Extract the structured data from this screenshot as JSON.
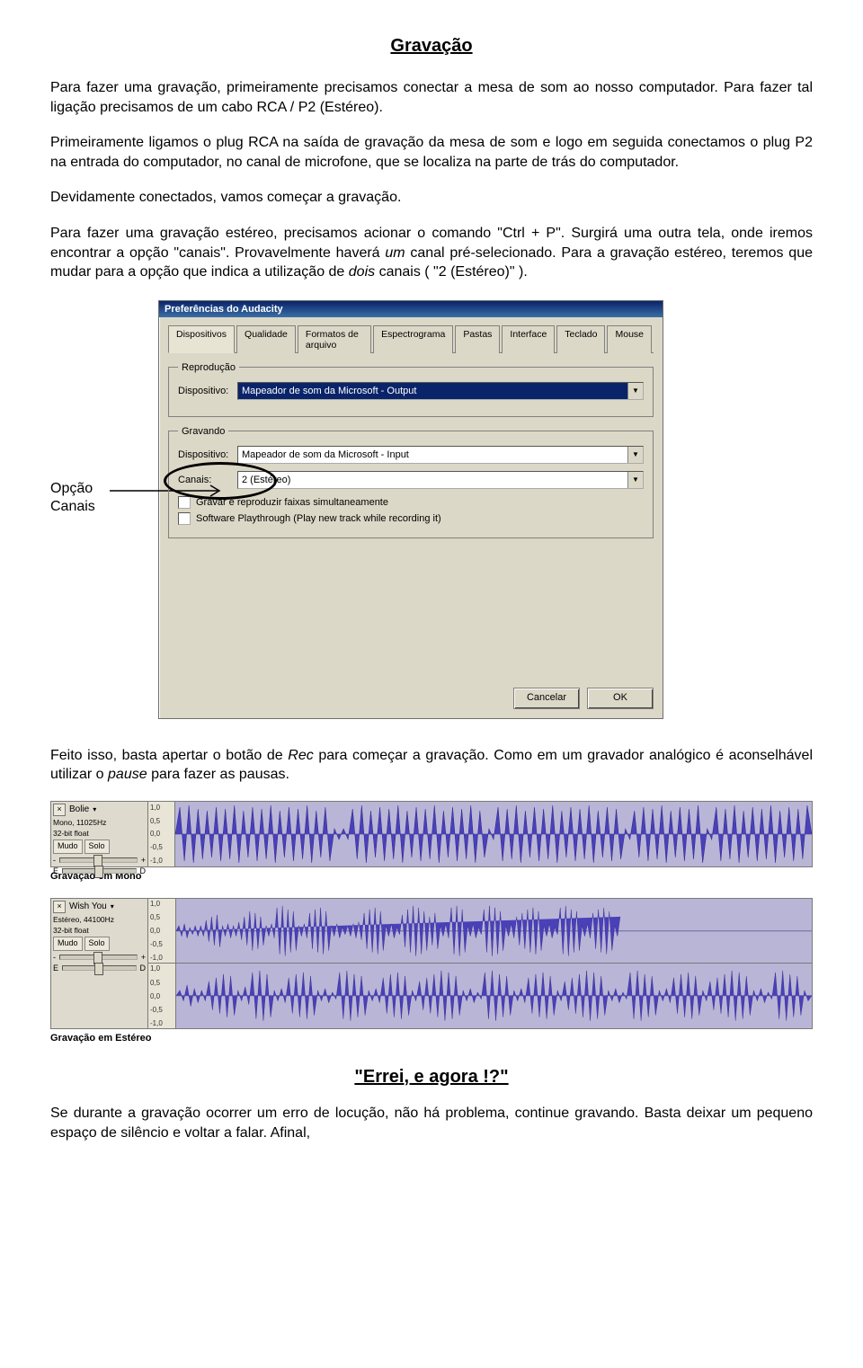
{
  "title": "Gravação",
  "para1": "Para fazer uma gravação, primeiramente precisamos conectar a mesa de som ao nosso computador. Para fazer tal ligação precisamos de um cabo RCA / P2 (Estéreo).",
  "para2": "Primeiramente ligamos o plug RCA na saída de gravação da mesa de som e logo em seguida conectamos o plug P2 na entrada do computador, no canal de microfone, que se localiza na parte de trás do computador.",
  "para3": "Devidamente conectados, vamos começar a gravação.",
  "para4a": "Para fazer uma gravação estéreo, precisamos acionar o comando \"Ctrl + P\". Surgirá uma outra tela, onde iremos encontrar a opção \"canais\". Provavelmente haverá ",
  "para4b_italic": "um",
  "para4c": " canal pré-selecionado. Para a gravação estéreo,  teremos que mudar para a opção que indica a utilização de ",
  "para4d_italic": "dois",
  "para4e": " canais ( \"2 (Estéreo)\" ).",
  "annotation_label_l1": "Opção",
  "annotation_label_l2": "Canais",
  "dialog": {
    "title": "Preferências do Audacity",
    "tabs": [
      "Dispositivos",
      "Qualidade",
      "Formatos de arquivo",
      "Espectrograma",
      "Pastas",
      "Interface",
      "Teclado",
      "Mouse"
    ],
    "group_playback": "Reprodução",
    "group_recording": "Gravando",
    "label_device": "Dispositivo:",
    "label_channels": "Canais:",
    "device_playback_value": "Mapeador de som da Microsoft - Output",
    "device_record_value": "Mapeador de som da Microsoft - Input",
    "channels_value": "2 (Estéreo)",
    "checkbox1": "Gravar e reproduzir faixas simultaneamente",
    "checkbox2": "Software Playthrough (Play new track while recording it)",
    "btn_cancel": "Cancelar",
    "btn_ok": "OK"
  },
  "para5a": "Feito isso, basta apertar o botão de ",
  "para5b_italic": "Rec",
  "para5c": " para começar a gravação. Como em um gravador analógico é aconselhável utilizar o ",
  "para5d_italic": "pause",
  "para5e": " para fazer as pausas.",
  "track_mono": {
    "name": "Bolie",
    "line1": "Mono, 11025Hz",
    "line2": "32-bit float",
    "btn_mute": "Mudo",
    "btn_solo": "Solo",
    "slider_left": "-",
    "slider_right": "+",
    "pan_left": "E",
    "pan_right": "D",
    "scale": [
      "1,0",
      "0,5",
      "0,0",
      "-0,5",
      "-1,0"
    ]
  },
  "caption_mono": "Gravação em Mono",
  "track_stereo": {
    "name": "Wish You",
    "line1": "Estéreo, 44100Hz",
    "line2": "32-bit float",
    "btn_mute": "Mudo",
    "btn_solo": "Solo",
    "slider_left": "-",
    "slider_right": "+",
    "pan_left": "E",
    "pan_right": "D",
    "scale": [
      "1,0",
      "0,5",
      "0,0",
      "-0,5",
      "-1,0"
    ]
  },
  "caption_stereo": "Gravação em Estéreo",
  "subheading": "\"Errei, e agora !?\"",
  "para6": "Se durante a gravação ocorrer um erro de locução, não há problema, continue gravando. Basta deixar um pequeno espaço de silêncio e voltar a falar. Afinal,"
}
